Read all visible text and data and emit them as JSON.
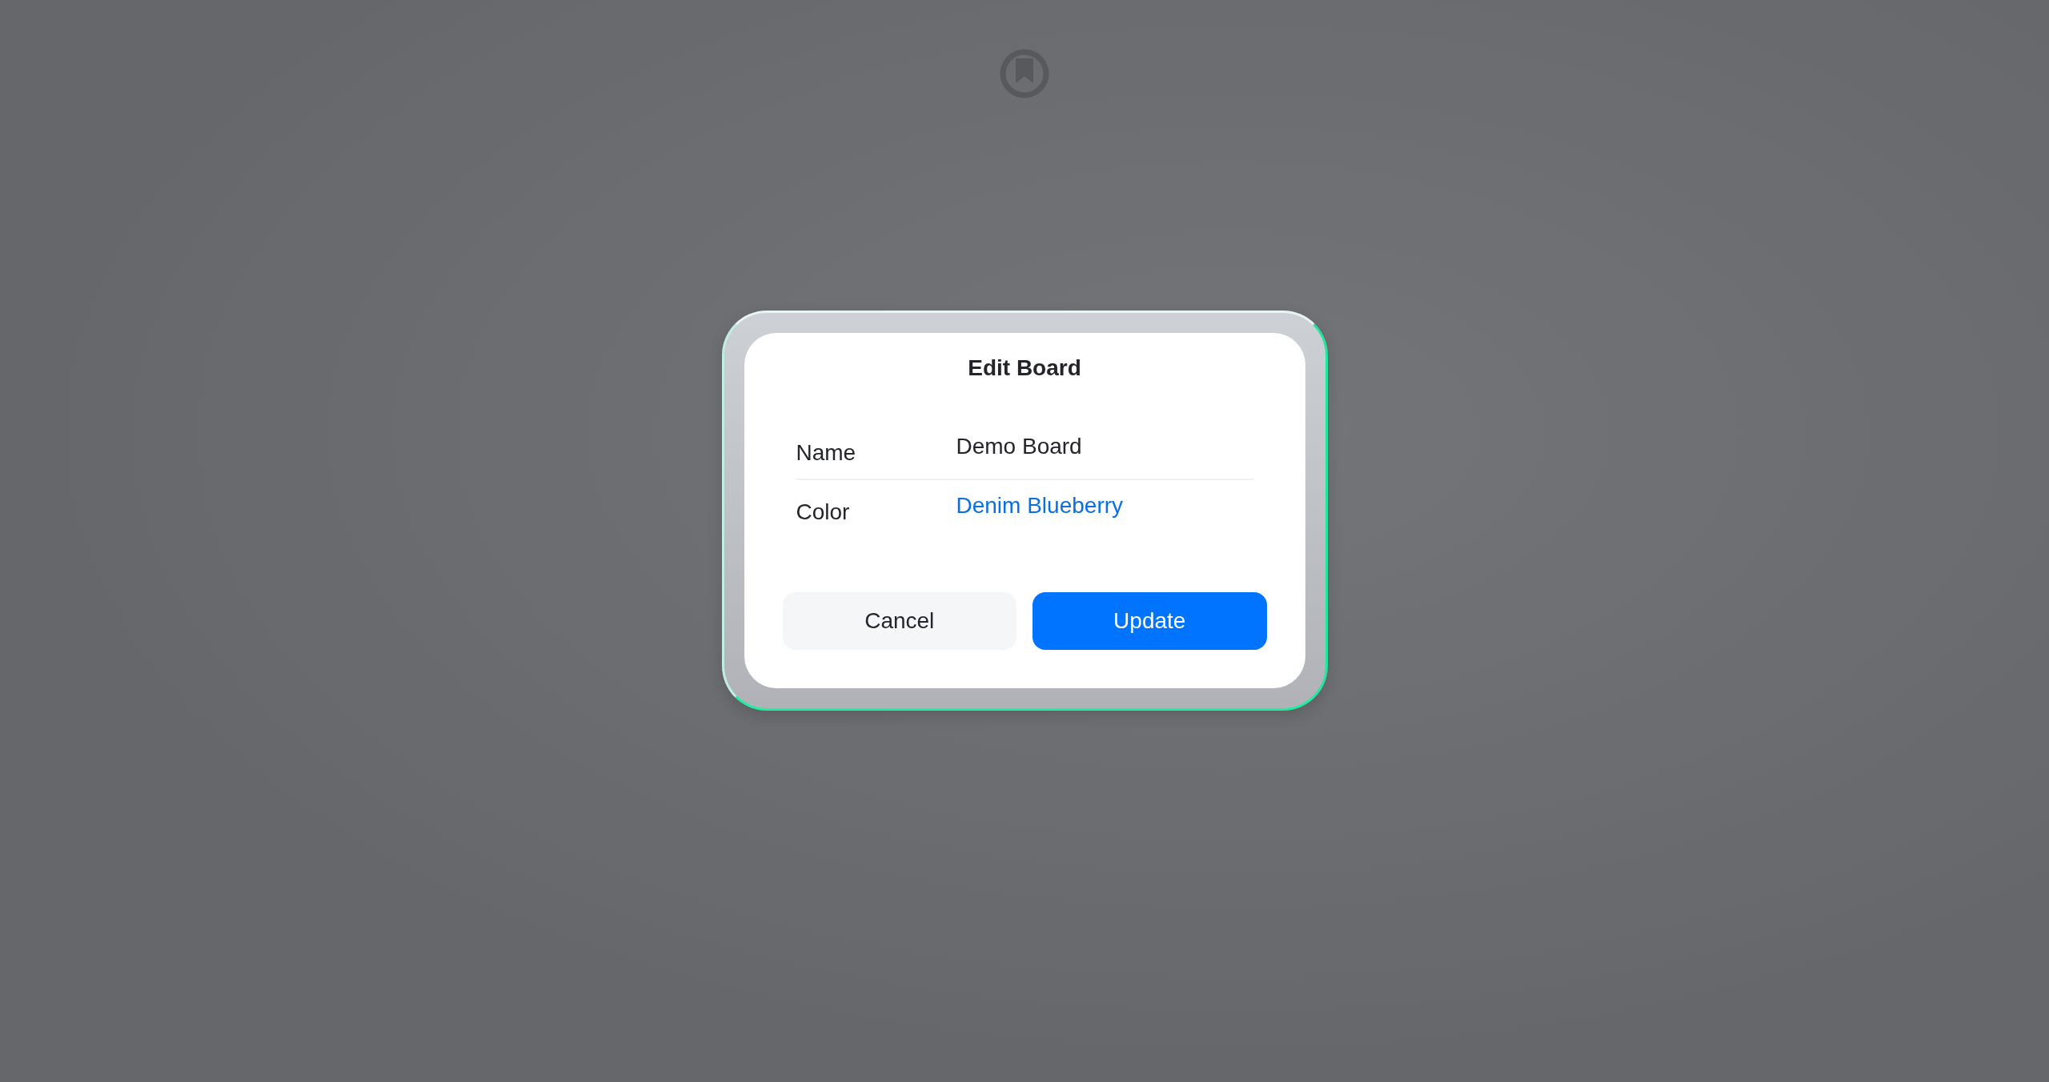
{
  "dialog": {
    "title": "Edit Board",
    "fields": [
      {
        "label": "Name",
        "value": "Demo Board",
        "kind": "text"
      },
      {
        "label": "Color",
        "value": "Denim Blueberry",
        "kind": "link"
      }
    ],
    "buttons": [
      {
        "label": "Cancel",
        "kind": "secondary"
      },
      {
        "label": "Update",
        "kind": "primary"
      }
    ]
  }
}
